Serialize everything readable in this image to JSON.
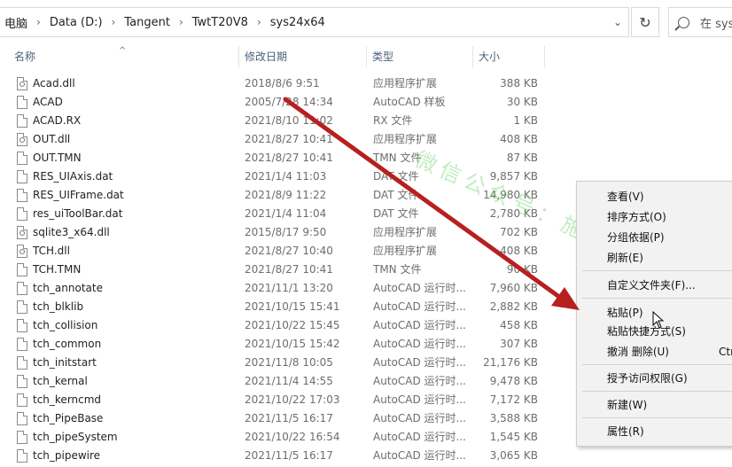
{
  "breadcrumb": {
    "items": [
      "电脑",
      "Data (D:)",
      "Tangent",
      "TwtT20V8",
      "sys24x64"
    ]
  },
  "search": {
    "placeholder": "在 sys"
  },
  "columns": {
    "name": "名称",
    "date": "修改日期",
    "type": "类型",
    "size": "大小"
  },
  "files": [
    {
      "name": "Acad.dll",
      "date": "2018/8/6 9:51",
      "type": "应用程序扩展",
      "size": "388 KB",
      "icon": "dll-file-icon"
    },
    {
      "name": "ACAD",
      "date": "2005/7/28 14:34",
      "type": "AutoCAD 样板",
      "size": "30 KB",
      "icon": "file-icon"
    },
    {
      "name": "ACAD.RX",
      "date": "2021/8/10 11:02",
      "type": "RX 文件",
      "size": "1 KB",
      "icon": "file-icon"
    },
    {
      "name": "OUT.dll",
      "date": "2021/8/27 10:41",
      "type": "应用程序扩展",
      "size": "408 KB",
      "icon": "dll-file-icon"
    },
    {
      "name": "OUT.TMN",
      "date": "2021/8/27 10:41",
      "type": "TMN 文件",
      "size": "87 KB",
      "icon": "file-icon"
    },
    {
      "name": "RES_UIAxis.dat",
      "date": "2021/1/4 11:03",
      "type": "DAT 文件",
      "size": "9,857 KB",
      "icon": "file-icon"
    },
    {
      "name": "RES_UIFrame.dat",
      "date": "2021/8/9 11:22",
      "type": "DAT 文件",
      "size": "14,980 KB",
      "icon": "file-icon"
    },
    {
      "name": "res_uiToolBar.dat",
      "date": "2021/1/4 11:04",
      "type": "DAT 文件",
      "size": "2,780 KB",
      "icon": "file-icon"
    },
    {
      "name": "sqlite3_x64.dll",
      "date": "2015/8/17 9:50",
      "type": "应用程序扩展",
      "size": "702 KB",
      "icon": "dll-file-icon"
    },
    {
      "name": "TCH.dll",
      "date": "2021/8/27 10:40",
      "type": "应用程序扩展",
      "size": "408 KB",
      "icon": "dll-file-icon"
    },
    {
      "name": "TCH.TMN",
      "date": "2021/8/27 10:41",
      "type": "TMN 文件",
      "size": "90 KB",
      "icon": "file-icon"
    },
    {
      "name": "tch_annotate",
      "date": "2021/11/1 13:20",
      "type": "AutoCAD 运行时...",
      "size": "7,960 KB",
      "icon": "file-icon"
    },
    {
      "name": "tch_blklib",
      "date": "2021/10/15 15:41",
      "type": "AutoCAD 运行时...",
      "size": "2,882 KB",
      "icon": "file-icon"
    },
    {
      "name": "tch_collision",
      "date": "2021/10/22 15:45",
      "type": "AutoCAD 运行时...",
      "size": "458 KB",
      "icon": "file-icon"
    },
    {
      "name": "tch_common",
      "date": "2021/10/15 15:42",
      "type": "AutoCAD 运行时...",
      "size": "307 KB",
      "icon": "file-icon"
    },
    {
      "name": "tch_initstart",
      "date": "2021/11/8 10:05",
      "type": "AutoCAD 运行时...",
      "size": "21,176 KB",
      "icon": "file-icon"
    },
    {
      "name": "tch_kernal",
      "date": "2021/11/4 14:55",
      "type": "AutoCAD 运行时...",
      "size": "9,478 KB",
      "icon": "file-icon"
    },
    {
      "name": "tch_kerncmd",
      "date": "2021/10/22 17:03",
      "type": "AutoCAD 运行时...",
      "size": "7,172 KB",
      "icon": "file-icon"
    },
    {
      "name": "tch_PipeBase",
      "date": "2021/11/5 16:17",
      "type": "AutoCAD 运行时...",
      "size": "3,588 KB",
      "icon": "file-icon"
    },
    {
      "name": "tch_pipeSystem",
      "date": "2021/10/22 16:54",
      "type": "AutoCAD 运行时...",
      "size": "1,545 KB",
      "icon": "file-icon"
    },
    {
      "name": "tch_pipewire",
      "date": "2021/11/5 16:17",
      "type": "AutoCAD 运行时...",
      "size": "3,065 KB",
      "icon": "file-icon"
    }
  ],
  "watermark": "微信公众号：施工者",
  "context_menu": {
    "view": "查看(V)",
    "sort": "排序方式(O)",
    "group": "分组依据(P)",
    "refresh": "刷新(E)",
    "customize": "自定义文件夹(F)...",
    "paste": "粘贴(P)",
    "paste_shortcut": "粘贴快捷方式(S)",
    "undo_delete": "撤消 删除(U)",
    "undo_shortcut": "Ctrl+Z",
    "grant_access": "授予访问权限(G)",
    "new": "新建(W)",
    "properties": "属性(R)"
  },
  "colors": {
    "arrow": "#b81f1f",
    "watermark": "#50c850",
    "header_text": "#4c607a"
  }
}
